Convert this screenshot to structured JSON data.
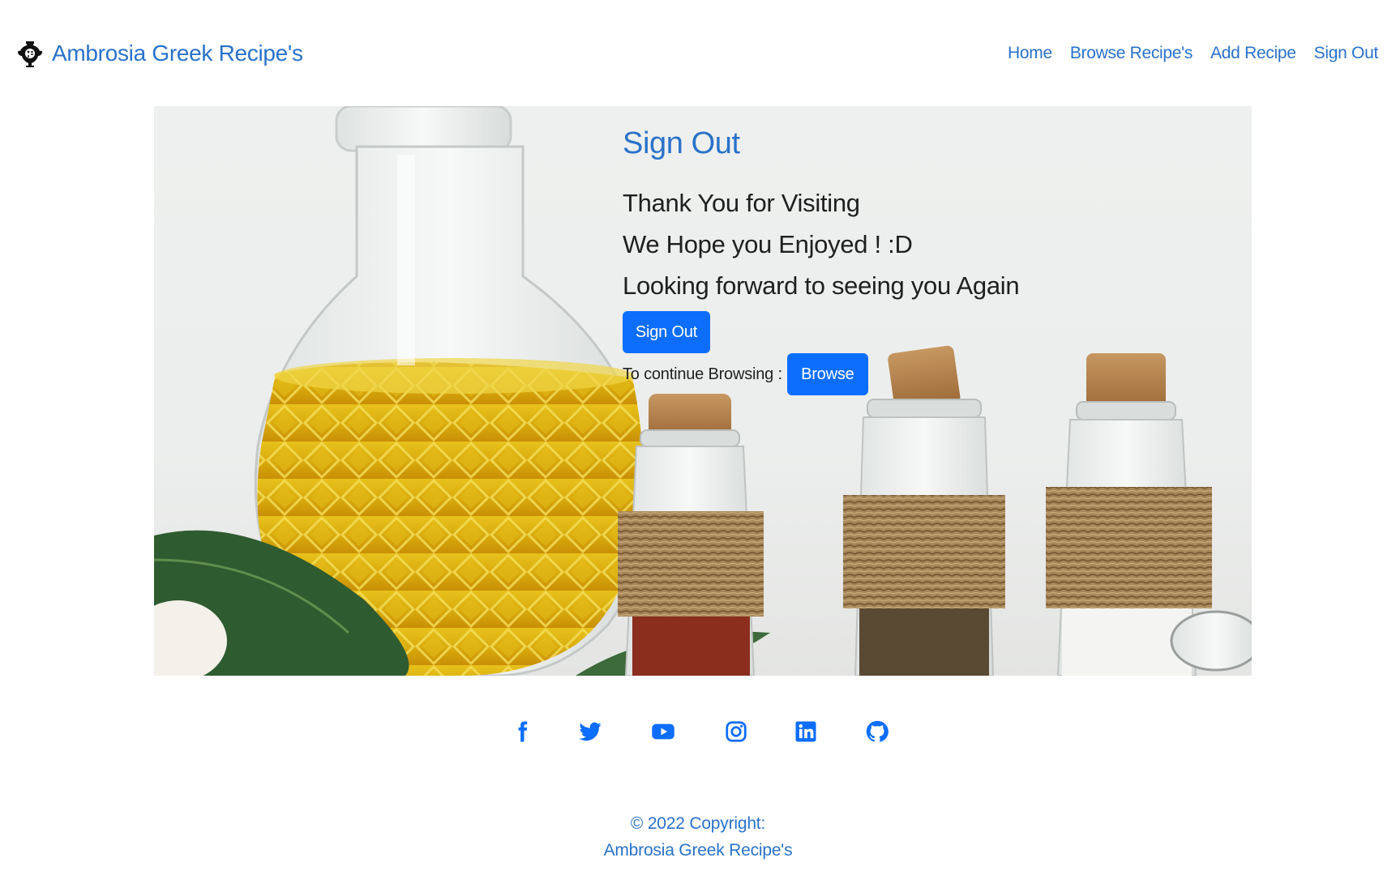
{
  "navbar": {
    "brand_text": "Ambrosia Greek Recipe's",
    "brand_icon": "greek-amphora-icon",
    "links": [
      {
        "label": "Home"
      },
      {
        "label": "Browse Recipe's"
      },
      {
        "label": "Add Recipe"
      },
      {
        "label": "Sign Out"
      }
    ]
  },
  "hero": {
    "background": "olive-oil-and-spice-jars-photo",
    "heading": "Sign Out",
    "messages": [
      "Thank You for Visiting",
      "We Hope you Enjoyed ! :D",
      "Looking forward to seeing you Again"
    ],
    "signout_button": "Sign Out",
    "continue_text": "To continue Browsing :",
    "browse_button": "Browse"
  },
  "social": {
    "icons": [
      "facebook-icon",
      "twitter-icon",
      "youtube-icon",
      "instagram-icon",
      "linkedin-icon",
      "github-icon"
    ]
  },
  "footer": {
    "copyright": "© 2022 Copyright:",
    "site_name": "Ambrosia Greek Recipe's"
  },
  "colors": {
    "accent": "#0d6efd",
    "link": "#2a72c9",
    "text": "#1f1f1f"
  }
}
